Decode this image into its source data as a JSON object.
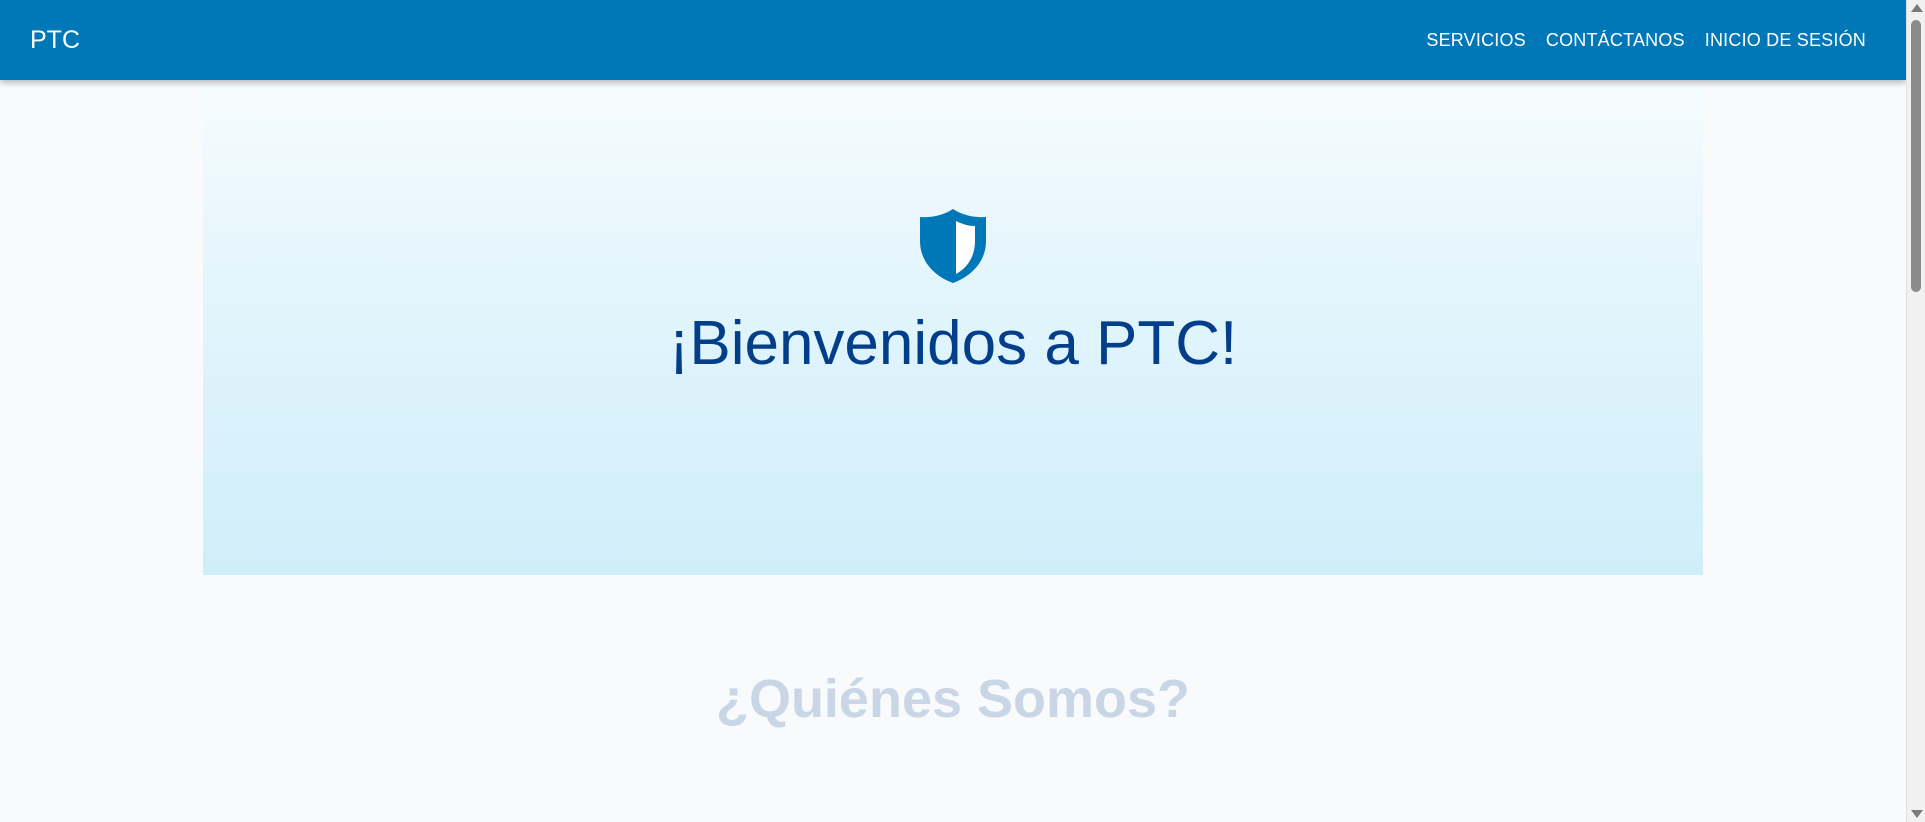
{
  "navbar": {
    "brand": "PTC",
    "links": [
      {
        "label": "SERVICIOS"
      },
      {
        "label": "CONTÁCTANOS"
      },
      {
        "label": "INICIO DE SESIÓN"
      }
    ],
    "background_color": "#0077b6"
  },
  "hero": {
    "icon": "shield-icon",
    "title": "¡Bienvenidos a PTC!",
    "title_color": "#023e8a"
  },
  "about": {
    "title": "¿Quiénes Somos?"
  }
}
